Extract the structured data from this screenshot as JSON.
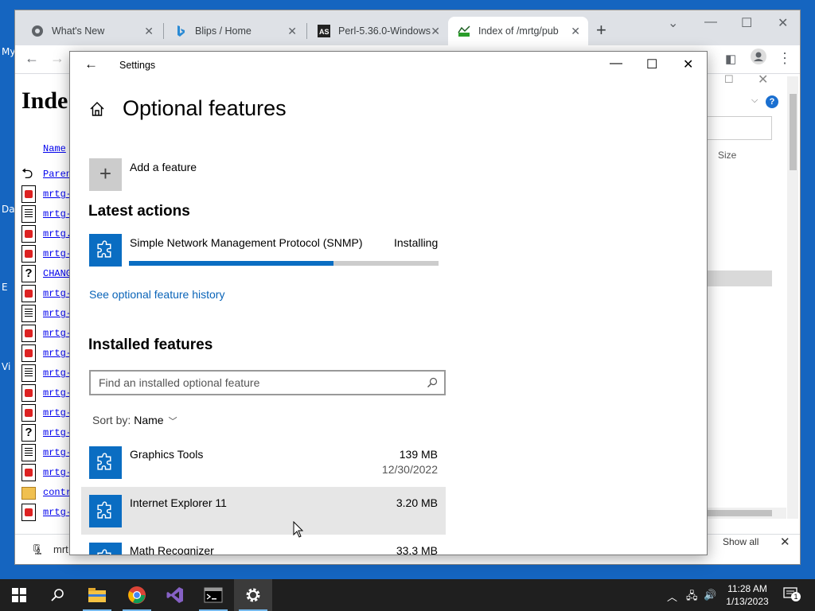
{
  "desktop": {
    "labels": [
      "My",
      "Da",
      "E",
      "Vi"
    ]
  },
  "browser": {
    "tabs": [
      {
        "title": "What's New",
        "icon": "chrome-icon"
      },
      {
        "title": "Blips / Home",
        "icon": "bing-icon"
      },
      {
        "title": "Perl-5.36.0-Windows",
        "icon": "activestate-icon"
      },
      {
        "title": "Index of /mrtg/pub",
        "icon": "mrtg-icon",
        "active": true
      }
    ],
    "page_title": "Inde",
    "column_name": "Name",
    "files": [
      {
        "name": "Paren",
        "type": "back"
      },
      {
        "name": "mrtg-",
        "type": "img"
      },
      {
        "name": "mrtg-",
        "type": "txt"
      },
      {
        "name": "mrtg.",
        "type": "img"
      },
      {
        "name": "mrtg-",
        "type": "img"
      },
      {
        "name": "CHANG",
        "type": "unk"
      },
      {
        "name": "mrtg-",
        "type": "img"
      },
      {
        "name": "mrtg-",
        "type": "txt"
      },
      {
        "name": "mrtg-",
        "type": "img"
      },
      {
        "name": "mrtg-",
        "type": "img"
      },
      {
        "name": "mrtg-",
        "type": "txt"
      },
      {
        "name": "mrtg-",
        "type": "img"
      },
      {
        "name": "mrtg-",
        "type": "img"
      },
      {
        "name": "mrtg-",
        "type": "unk"
      },
      {
        "name": "mrtg-",
        "type": "txt"
      },
      {
        "name": "mrtg-",
        "type": "img"
      },
      {
        "name": "contr",
        "type": "dir"
      },
      {
        "name": "mrtg-",
        "type": "img"
      }
    ],
    "download_item": "mrt",
    "behind_window": {
      "size_header": "Size",
      "show_all": "Show all"
    }
  },
  "settings": {
    "window_title": "Settings",
    "heading": "Optional features",
    "add_feature": "Add a feature",
    "latest_actions_heading": "Latest actions",
    "latest_action": {
      "name": "Simple Network Management Protocol (SNMP)",
      "status": "Installing",
      "progress": 0.66
    },
    "history_link": "See optional feature history",
    "installed_heading": "Installed features",
    "search_placeholder": "Find an installed optional feature",
    "sort_label": "Sort by:",
    "sort_value": "Name",
    "installed": [
      {
        "name": "Graphics Tools",
        "size": "139 MB",
        "date": "12/30/2022"
      },
      {
        "name": "Internet Explorer 11",
        "size": "3.20 MB",
        "date": ""
      },
      {
        "name": "Math Recognizer",
        "size": "33.3 MB",
        "date": ""
      }
    ]
  },
  "taskbar": {
    "time": "11:28 AM",
    "date": "1/13/2023",
    "notification_count": "1",
    "apps": [
      "start-icon",
      "search-icon",
      "file-explorer-icon",
      "chrome-icon",
      "visual-studio-icon",
      "terminal-icon",
      "settings-icon"
    ]
  },
  "colors": {
    "accent": "#0a6dc2",
    "link": "#0a64b8",
    "taskbar": "#1f1f1f",
    "desktop": "#1565c0"
  }
}
